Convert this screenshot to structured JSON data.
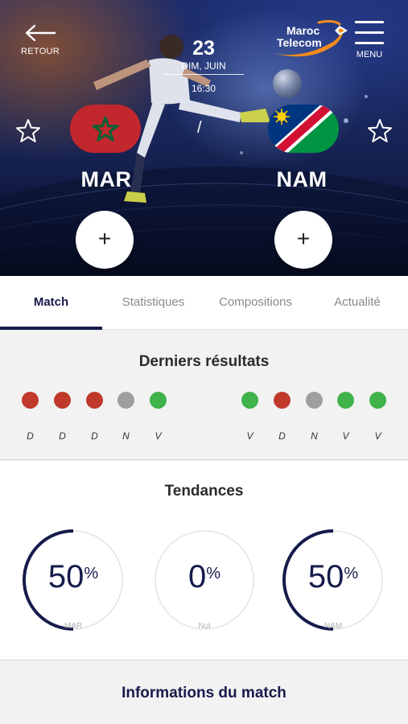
{
  "header": {
    "back_label": "RETOUR",
    "brand": {
      "line1": "Maroc",
      "line2": "Telecom"
    },
    "menu_label": "MENU",
    "date": {
      "day": "23",
      "weekday_month": "DIM, JUIN",
      "time": "16:30"
    },
    "separator": "/"
  },
  "teams": {
    "home": {
      "code": "MAR",
      "flag_icon": "morocco-flag-icon"
    },
    "away": {
      "code": "NAM",
      "flag_icon": "namibia-flag-icon"
    }
  },
  "tabs": [
    {
      "label": "Match",
      "active": true
    },
    {
      "label": "Statistiques",
      "active": false
    },
    {
      "label": "Compositions",
      "active": false
    },
    {
      "label": "Actualité",
      "active": false
    }
  ],
  "recent_results": {
    "title": "Derniers résultats",
    "home": [
      "D",
      "D",
      "D",
      "N",
      "V"
    ],
    "away": [
      "V",
      "D",
      "N",
      "V",
      "V"
    ],
    "colors": {
      "D": "#c0392b",
      "N": "#9e9e9e",
      "V": "#3fb34a"
    }
  },
  "trends": {
    "title": "Tendances",
    "items": [
      {
        "value": "50",
        "unit": "%",
        "label": "MAR",
        "fraction": 0.5
      },
      {
        "value": "0",
        "unit": "%",
        "label": "Nul",
        "fraction": 0
      },
      {
        "value": "50",
        "unit": "%",
        "label": "NAM",
        "fraction": 0.5
      }
    ]
  },
  "info": {
    "title": "Informations du match"
  },
  "colors": {
    "navy": "#161b4b",
    "accent_orange": "#f28c1e"
  }
}
